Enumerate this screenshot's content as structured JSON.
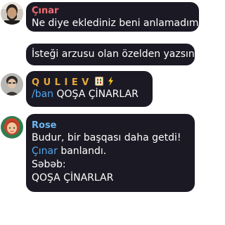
{
  "colors": {
    "bubble_background": "#1b1a24",
    "message_text": "#ffffff",
    "sender_cinar": "#ef6b73",
    "sender_quliev": "#e6a83a",
    "sender_rose": "#6cb7f0",
    "link": "#52a6f0"
  },
  "messages": [
    {
      "sender": "Çınar",
      "avatar": "avatar-bearded-man",
      "lines": [
        "Ne diye eklediniz beni anlamadım"
      ]
    },
    {
      "lines": [
        "İsteği arzusu olan özelden yazsın"
      ]
    },
    {
      "sender": "Q U L I E V",
      "sender_badges": [
        "mahjong-tile-icon",
        "lightning-icon"
      ],
      "avatar": "avatar-young-man",
      "command": "/ban",
      "command_argument": " QOŞA ÇİNARLAR"
    },
    {
      "sender": "Rose",
      "avatar": "avatar-red-hair-cartoon",
      "lines": [
        "Budur, bir başqası daha getdi!"
      ],
      "mention": "Çınar",
      "mention_suffix": " banlandı.",
      "reason_label": "Səbəb:",
      "reason_value": "QOŞA ÇİNARLAR"
    }
  ]
}
